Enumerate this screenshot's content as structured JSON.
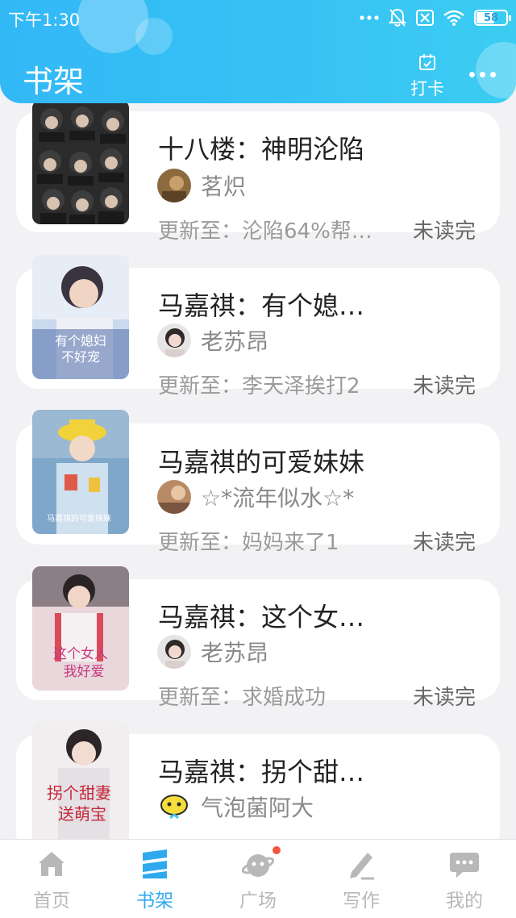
{
  "status_bar": {
    "time": "下午1:30",
    "battery": "58"
  },
  "header": {
    "title": "书架",
    "checkin_label": "打卡"
  },
  "books": [
    {
      "title": "十八楼：神明沦陷",
      "author": "茗炽",
      "update": "更新至：沦陷64%帮…",
      "status": "未读完"
    },
    {
      "title": "马嘉祺：有个媳…",
      "author": "老苏昂",
      "update": "更新至：李天泽挨打2",
      "status": "未读完"
    },
    {
      "title": "马嘉祺的可爱妹妹",
      "author": "☆*流年似水☆*",
      "update": "更新至：妈妈来了1",
      "status": "未读完"
    },
    {
      "title": "马嘉祺：这个女…",
      "author": "老苏昂",
      "update": "更新至：求婚成功",
      "status": "未读完"
    },
    {
      "title": "马嘉祺：拐个甜…",
      "author": "气泡菌阿大",
      "update": "",
      "status": ""
    }
  ],
  "bottom_nav": [
    {
      "label": "首页",
      "icon": "home-icon"
    },
    {
      "label": "书架",
      "icon": "bookshelf-icon",
      "active": true
    },
    {
      "label": "广场",
      "icon": "square-icon",
      "badge": true
    },
    {
      "label": "写作",
      "icon": "write-icon"
    },
    {
      "label": "我的",
      "icon": "profile-icon"
    }
  ],
  "colors": {
    "header_start": "#33b8f6",
    "header_end": "#3ccdf2",
    "active_tab": "#2fa9ee",
    "badge": "#f4553b"
  }
}
